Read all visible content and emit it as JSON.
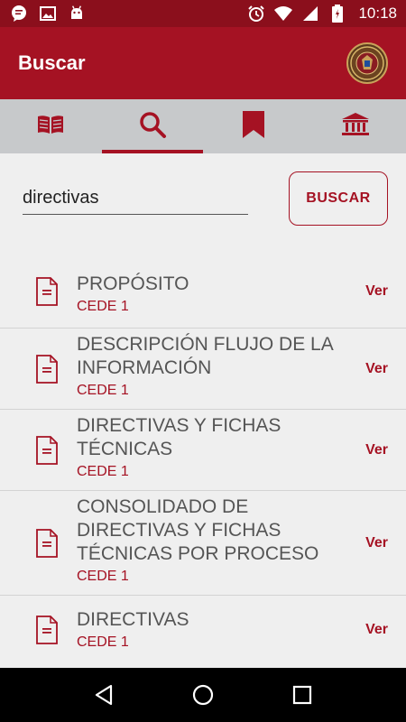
{
  "status_bar": {
    "time": "10:18",
    "left_icons": [
      "chat-icon",
      "image-icon",
      "android-icon"
    ],
    "right_icons": [
      "alarm-icon",
      "wifi-icon",
      "signal-icon",
      "battery-icon"
    ]
  },
  "app_bar": {
    "title": "Buscar",
    "logo": "emblem-logo"
  },
  "tabs": [
    {
      "icon": "book-icon",
      "active": false
    },
    {
      "icon": "search-icon",
      "active": true
    },
    {
      "icon": "bookmark-icon",
      "active": false
    },
    {
      "icon": "institution-icon",
      "active": false
    }
  ],
  "search": {
    "value": "directivas",
    "button_label": "BUSCAR"
  },
  "results": [
    {
      "title": "PROPÓSITO",
      "subtitle": "CEDE 1",
      "action": "Ver"
    },
    {
      "title": "DESCRIPCIÓN FLUJO DE LA INFORMACIÓN",
      "subtitle": "CEDE 1",
      "action": "Ver"
    },
    {
      "title": "DIRECTIVAS Y FICHAS TÉCNICAS",
      "subtitle": "CEDE 1",
      "action": "Ver"
    },
    {
      "title": "CONSOLIDADO DE DIRECTIVAS Y FICHAS TÉCNICAS POR PROCESO",
      "subtitle": "CEDE 1",
      "action": "Ver"
    },
    {
      "title": "DIRECTIVAS",
      "subtitle": "CEDE 1",
      "action": "Ver"
    }
  ],
  "nav_bar": [
    "back-icon",
    "home-icon",
    "recents-icon"
  ],
  "colors": {
    "status_bar": "#8b0f1c",
    "primary": "#a51223",
    "tab_bar": "#c7c9cb",
    "background": "#efefef"
  }
}
